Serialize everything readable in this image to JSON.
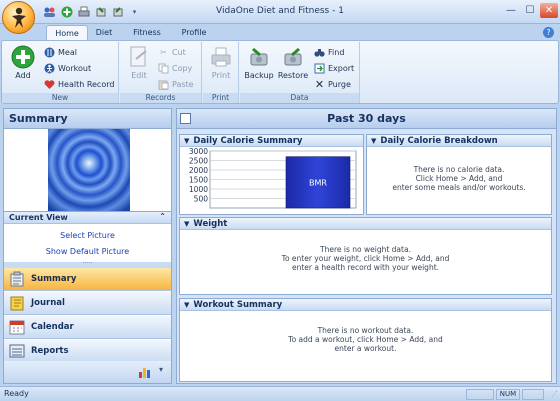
{
  "window": {
    "title": "VidaOne Diet and Fitness - 1",
    "controls": [
      "minimize",
      "maximize",
      "close"
    ]
  },
  "ribbon": {
    "tabs": [
      {
        "label": "Home",
        "active": true
      },
      {
        "label": "Diet",
        "active": false
      },
      {
        "label": "Fitness",
        "active": false
      },
      {
        "label": "Profile",
        "active": false
      }
    ],
    "groups": {
      "new": {
        "label": "New",
        "add": "Add",
        "meal": "Meal",
        "workout": "Workout",
        "health_record": "Health Record"
      },
      "records": {
        "label": "Records",
        "edit": "Edit",
        "cut": "Cut",
        "copy": "Copy",
        "paste": "Paste"
      },
      "print": {
        "label": "Print",
        "print": "Print"
      },
      "data": {
        "label": "Data",
        "backup": "Backup",
        "restore": "Restore",
        "find": "Find",
        "export": "Export",
        "purge": "Purge"
      }
    }
  },
  "left_panel": {
    "title": "Summary",
    "current_view": {
      "label": "Current View",
      "select_picture": "Select Picture",
      "show_default_picture": "Show Default Picture"
    },
    "nav": [
      {
        "label": "Summary",
        "icon": "summary-icon",
        "active": true
      },
      {
        "label": "Journal",
        "icon": "journal-icon",
        "active": false
      },
      {
        "label": "Calendar",
        "icon": "calendar-icon",
        "active": false
      },
      {
        "label": "Reports",
        "icon": "reports-icon",
        "active": false
      }
    ]
  },
  "main": {
    "title": "Past 30 days",
    "daily_calorie_summary": {
      "title": "Daily Calorie Summary"
    },
    "daily_calorie_breakdown": {
      "title": "Daily Calorie Breakdown",
      "message": [
        "There is no calorie data.",
        "Click Home > Add, and",
        "enter some meals and/or workouts."
      ]
    },
    "weight": {
      "title": "Weight",
      "message": [
        "There is no weight data.",
        "To enter your weight, click Home > Add, and",
        "enter a health record with your weight."
      ]
    },
    "workout_summary": {
      "title": "Workout Summary",
      "message": [
        "There is no workout data.",
        "To add a workout, click Home > Add, and",
        "enter a workout."
      ]
    }
  },
  "chart_data": {
    "type": "bar",
    "categories": [
      "BMR"
    ],
    "values": [
      2700
    ],
    "ylim": [
      0,
      3000
    ],
    "yticks": [
      500,
      1000,
      1500,
      2000,
      2500,
      3000
    ],
    "grid": true,
    "colors": {
      "bar": "#2f44d8"
    }
  },
  "status_bar": {
    "text": "Ready",
    "num": "NUM"
  }
}
